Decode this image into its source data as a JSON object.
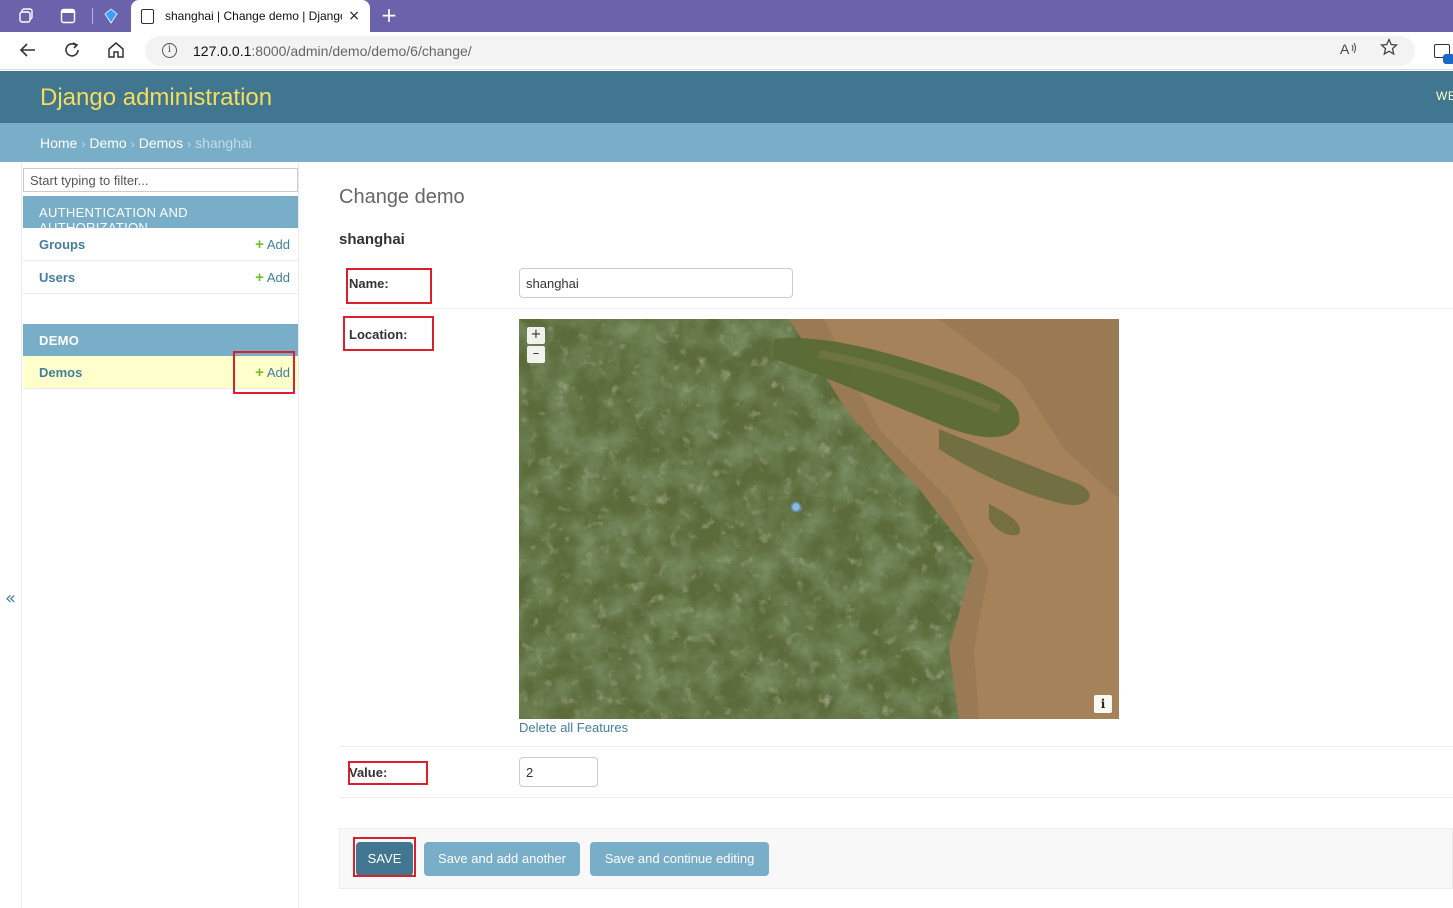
{
  "browser": {
    "tab_title": "shanghai | Change demo | Django",
    "close_glyph": "×",
    "new_tab_glyph": "+",
    "url_host": "127.0.0.1",
    "url_path": ":8000/admin/demo/demo/6/change/",
    "read_aloud": "A͂",
    "icons": [
      "workspaces-icon",
      "tab-actions-icon",
      "copilot-icon",
      "page-icon",
      "close-icon",
      "new-tab-icon",
      "back-icon",
      "refresh-icon",
      "home-icon",
      "info-icon",
      "read-aloud-icon",
      "favorite-star-icon",
      "collections-icon"
    ],
    "accent": "#6a63ac"
  },
  "header": {
    "brand": "Django administration",
    "user_tools": "WE",
    "bg_color": "#417690",
    "brand_color": "#f5dd5d"
  },
  "breadcrumbs": {
    "home": "Home",
    "app": "Demo",
    "model": "Demos",
    "current": "shanghai",
    "separator": "›"
  },
  "sidebar": {
    "filter_placeholder": "Start typing to filter...",
    "toggle_glyph": "«",
    "modules": [
      {
        "caption": "AUTHENTICATION AND AUTHORIZATION",
        "models": [
          {
            "name": "Groups",
            "add": "Add"
          },
          {
            "name": "Users",
            "add": "Add"
          }
        ]
      },
      {
        "caption": "DEMO",
        "models": [
          {
            "name": "Demos",
            "add": "Add",
            "current": true
          }
        ]
      }
    ]
  },
  "main": {
    "page_title": "Change demo",
    "object_title": "shanghai",
    "fields": {
      "name": {
        "label": "Name:",
        "value": "shanghai"
      },
      "location": {
        "label": "Location:",
        "zoom_in": "+",
        "zoom_out": "–",
        "attribution": "i",
        "delete_link": "Delete all Features"
      },
      "value": {
        "label": "Value:",
        "value": "2"
      }
    },
    "buttons": {
      "save": "SAVE",
      "save_add_another": "Save and add another",
      "save_continue": "Save and continue editing"
    },
    "highlight_color": "#d9202b"
  }
}
